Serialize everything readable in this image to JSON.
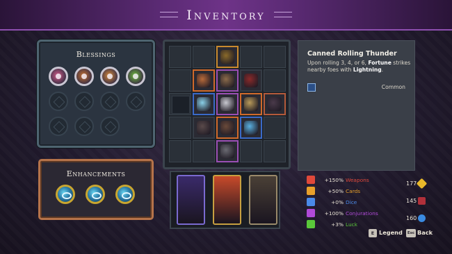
{
  "title": "Inventory",
  "blessings": {
    "title": "Blessings",
    "active": [
      {
        "icon": "heart-blessing-icon",
        "color": "#d45a8a"
      },
      {
        "icon": "wizard-blessing-icon",
        "color": "#c7722f"
      },
      {
        "icon": "skull-blessing-icon",
        "color": "#d88a3a"
      },
      {
        "icon": "cross-blessing-icon",
        "color": "#6fbf3a"
      }
    ],
    "empty_count": 7
  },
  "enhancements": {
    "title": "Enhancements",
    "items": [
      {
        "icon": "ring-enhancement-icon"
      },
      {
        "icon": "ring-enhancement-icon"
      },
      {
        "icon": "ring-enhancement-icon"
      }
    ]
  },
  "inventory_items": [
    {
      "name": "plant-pot-item",
      "border": "#c98a2e",
      "color": "#8a6a2a"
    },
    {
      "name": "scroll-item",
      "border": "#d06a2a",
      "color": "#b86a3a"
    },
    {
      "name": "sack-item",
      "border": "#9a4fb4",
      "color": "#8a6a4a"
    },
    {
      "name": "red-chest-item",
      "border": "#353c45",
      "color": "#8a2a2a"
    },
    {
      "name": "cloud-item",
      "border": "#3a6ac8",
      "color": "#8ad0e8"
    },
    {
      "name": "spiderweb-item",
      "border": "#9a4fb4",
      "color": "#c8c8d0"
    },
    {
      "name": "map-item",
      "border": "#d06a2a",
      "color": "#b89a5a"
    },
    {
      "name": "dark-orb-item",
      "border": "#b45a3a",
      "color": "#4a3a4a"
    },
    {
      "name": "bomb-item",
      "border": "#353c45",
      "color": "#5a4a4a"
    },
    {
      "name": "cauldron-item",
      "border": "#d06a2a",
      "color": "#6a4a3a"
    },
    {
      "name": "canned-thunder-item",
      "border": "#3a6ac8",
      "color": "#5ab0e0"
    },
    {
      "name": "horn-item",
      "border": "#9a4fb4",
      "color": "#6a6a72"
    }
  ],
  "cards": [
    {
      "name": "sword-card",
      "border": "#7a6ad0",
      "color": "#3a2a6a"
    },
    {
      "name": "fire-monster-card",
      "border": "#c8a040",
      "color": "#c84a2a"
    },
    {
      "name": "dice-card",
      "border": "#9a8a6a",
      "color": "#4a4036"
    }
  ],
  "detail": {
    "title": "Canned Rolling Thunder",
    "desc_1": "Upon rolling 3, 4, or 6,",
    "desc_bold_1": "Fortune",
    "desc_2": "strikes nearby foes with",
    "desc_bold_2": "Lightning",
    "desc_3": ".",
    "rarity_icon": "dice-rarity-icon",
    "rarity": "Common"
  },
  "stats": [
    {
      "icon": "weapon-stat-icon",
      "value": "+150%",
      "label": "Weapons",
      "color": "#e0483a"
    },
    {
      "icon": "card-stat-icon",
      "value": "+50%",
      "label": "Cards",
      "color": "#e8a02a"
    },
    {
      "icon": "dice-stat-icon",
      "value": "+0%",
      "label": "Dice",
      "color": "#4a8ae8"
    },
    {
      "icon": "conjuration-stat-icon",
      "value": "+100%",
      "label": "Conjurations",
      "color": "#b04ad8"
    },
    {
      "icon": "luck-stat-icon",
      "value": "+3%",
      "label": "Luck",
      "color": "#5ac83a"
    }
  ],
  "resources": [
    {
      "value": "177",
      "icon": "gold-diamond-icon",
      "color": "#e8b82a"
    },
    {
      "value": "145",
      "icon": "chest-resource-icon",
      "color": "#b0303a"
    },
    {
      "value": "160",
      "icon": "soul-orb-icon",
      "color": "#3a8ae0"
    }
  ],
  "hints": {
    "legend_key": "E",
    "legend": "Legend",
    "back_key": "Esc",
    "back": "Back"
  }
}
